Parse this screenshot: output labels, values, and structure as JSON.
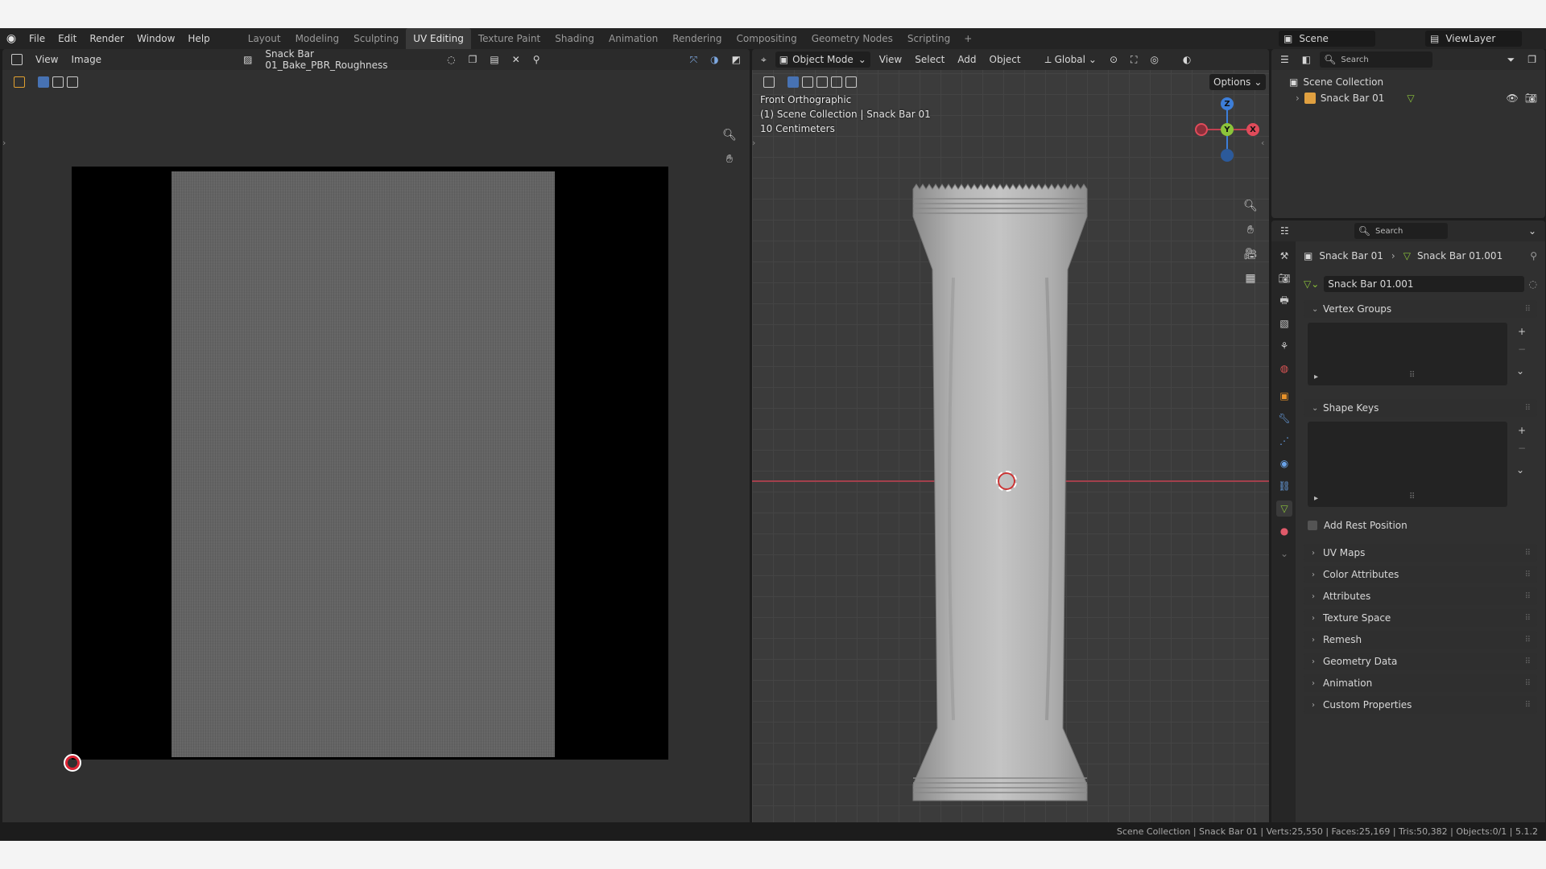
{
  "menu": {
    "items": [
      "File",
      "Edit",
      "Render",
      "Window",
      "Help"
    ]
  },
  "workspaces": {
    "tabs": [
      "Layout",
      "Modeling",
      "Sculpting",
      "UV Editing",
      "Texture Paint",
      "Shading",
      "Animation",
      "Rendering",
      "Compositing",
      "Geometry Nodes",
      "Scripting"
    ],
    "active": "UV Editing",
    "plus": "+"
  },
  "scene": {
    "name": "Scene",
    "view_layer": "ViewLayer"
  },
  "image_editor": {
    "view_label": "View",
    "image_label": "Image",
    "image_name": "Snack Bar 01_Bake_PBR_Roughness"
  },
  "viewport": {
    "mode": "Object Mode",
    "menus": [
      "View",
      "Select",
      "Add",
      "Object"
    ],
    "orientation": "Global",
    "options_label": "Options",
    "overlay_lines": [
      "Front Orthographic",
      "(1) Scene Collection | Snack Bar 01",
      "10 Centimeters"
    ],
    "gizmo": {
      "x": "X",
      "y": "Y",
      "z": "Z"
    }
  },
  "outliner": {
    "search_placeholder": "Search",
    "collection": "Scene Collection",
    "object": "Snack Bar 01"
  },
  "properties": {
    "search_placeholder": "Search",
    "breadcrumb_object": "Snack Bar 01",
    "breadcrumb_mesh": "Snack Bar 01.001",
    "mesh_name": "Snack Bar 01.001",
    "panels": {
      "vertex_groups": "Vertex Groups",
      "shape_keys": "Shape Keys",
      "add_rest_position": "Add Rest Position",
      "collapsed": [
        "UV Maps",
        "Color Attributes",
        "Attributes",
        "Texture Space",
        "Remesh",
        "Geometry Data",
        "Animation",
        "Custom Properties"
      ]
    }
  },
  "status": {
    "text": "Scene Collection | Snack Bar 01 | Verts:25,550 | Faces:25,169 | Tris:50,382 | Objects:0/1 | 5.1.2"
  },
  "colors": {
    "background": "#303030",
    "header": "#2b2b2b",
    "accent_blue": "#4772b3",
    "axis_x": "#e04b5a",
    "axis_y": "#8cc43a",
    "axis_z": "#3d7ed8"
  }
}
